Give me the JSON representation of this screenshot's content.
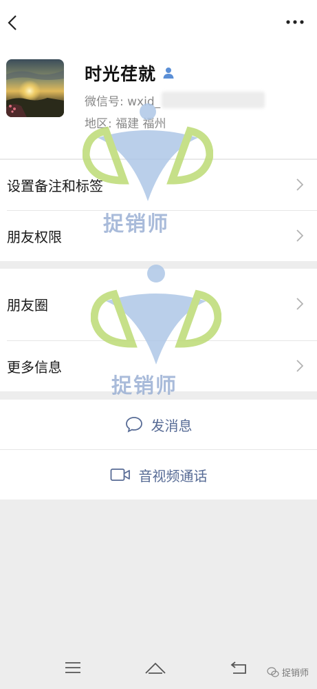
{
  "profile": {
    "name": "时光荏就",
    "wxid_label": "微信号: wxid_",
    "region_label": "地区: 福建  福州"
  },
  "menu_group_1": [
    {
      "label": "设置备注和标签"
    },
    {
      "label": "朋友权限"
    }
  ],
  "menu_group_2": [
    {
      "label": "朋友圈"
    },
    {
      "label": "更多信息"
    }
  ],
  "actions": {
    "message": "发消息",
    "call": "音视频通话"
  },
  "watermark": {
    "text": "捉销师",
    "footer": "捉销师"
  },
  "icons": {
    "back": "chevron-left-icon",
    "more": "more-dots-icon",
    "gender": "person-icon",
    "chevron": "chevron-right-icon",
    "message": "chat-bubble-icon",
    "video": "video-camera-icon",
    "nav_menu": "menu-icon",
    "nav_home": "home-icon",
    "nav_back": "return-icon",
    "wechat": "wechat-icon"
  },
  "colors": {
    "link": "#576b95",
    "gender_icon": "#5b8fd6",
    "watermark_blue": "#a9c4e6",
    "watermark_green": "#b9d96c"
  }
}
